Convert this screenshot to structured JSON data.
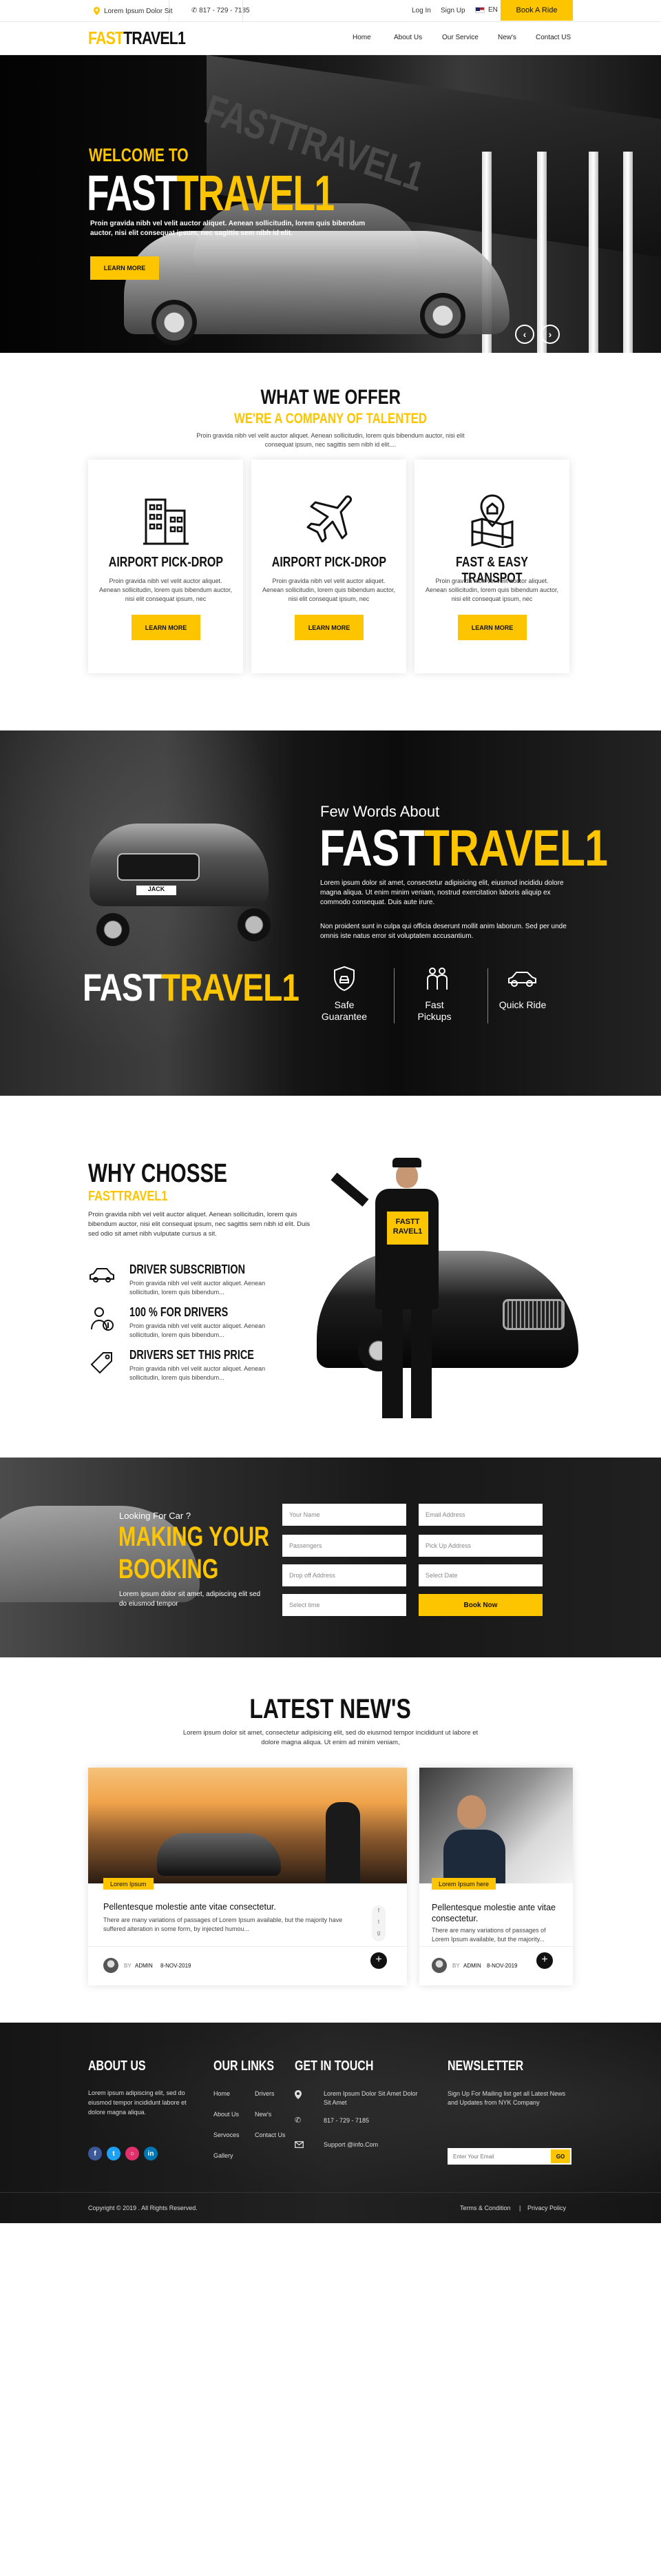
{
  "topbar": {
    "address": "Lorem Ipsum Dolor Sit",
    "phone": "817 - 729 - 7185",
    "login": "Log In",
    "signup": "Sign Up",
    "lang": "EN",
    "book_ride": "Book A Ride"
  },
  "brand": {
    "logo_a": "FAST",
    "logo_b": "TRAVEL1",
    "accent": "#fdc500"
  },
  "nav": {
    "items": [
      "Home",
      "About Us",
      "Our Service",
      "New's",
      "Contact US"
    ]
  },
  "hero": {
    "welcome": "WELCOME TO",
    "title_a": "FAST",
    "title_b": "TRAVEL1",
    "text": "Proin gravida nibh vel velit auctor aliquet. Aenean sollicitudin, lorem quis bibendum auctor, nisi elit consequat ipsum, nec sagittis sem nibh id elit.",
    "button": "LEARN MORE",
    "sign_text": "FASTTRAVEL1"
  },
  "offer": {
    "title": "WHAT WE OFFER",
    "subtitle": "WE'RE A COMPANY OF TALENTED",
    "text": "Proin gravida nibh vel velit auctor aliquet. Aenean sollicitudin, lorem quis bibendum auctor, nisi elit consequat ipsum, nec sagittis sem nibh id elit....",
    "cards": [
      {
        "title": "AIRPORT PICK-DROP",
        "text": "Proin gravida nibh vel velit auctor aliquet. Aenean sollicitudin, lorem quis bibendum auctor, nisi elit consequat ipsum, nec",
        "button": "LEARN MORE"
      },
      {
        "title": "AIRPORT PICK-DROP",
        "text": "Proin gravida nibh vel velit auctor aliquet. Aenean sollicitudin, lorem quis bibendum auctor, nisi elit consequat ipsum, nec",
        "button": "LEARN MORE"
      },
      {
        "title": "FAST & EASY TRANSPOT",
        "text": "Proin gravida nibh vel velit auctor aliquet. Aenean sollicitudin, lorem quis bibendum auctor, nisi elit consequat ipsum, nec",
        "button": "LEARN MORE"
      }
    ]
  },
  "about": {
    "kicker": "Few Words About",
    "title_a": "FAST",
    "title_b": "TRAVEL1",
    "p1": "Lorem ipsum dolor sit amet, consectetur adipisicing elit, eiusmod incididu dolore magna aliqua. Ut enim minim veniam, nostrud exercitation laboris aliquip ex commodo consequat. Duis aute irure.",
    "p2": "Non proident sunt in culpa qui officia deserunt mollit anim laborum. Sed per unde omnis iste natus error sit voluptatem accusantium.",
    "features": [
      {
        "label": "Safe Guarantee"
      },
      {
        "label": "Fast Pickups"
      },
      {
        "label": "Quick Ride"
      }
    ],
    "plate": "JACK"
  },
  "why": {
    "title": "WHY CHOSSE",
    "subtitle": "FASTTRAVEL1",
    "text": "Proin gravida nibh vel velit auctor aliquet. Aenean sollicitudin, lorem quis bibendum auctor, nisi elit consequat ipsum, nec sagittis sem nibh id elit. Duis sed odio sit amet nibh vulputate cursus a sit.",
    "items": [
      {
        "title": "DRIVER SUBSCRIBTION",
        "text": "Proin gravida nibh vel velit auctor aliquet. Aenean sollicitudin, lorem quis bibendum..."
      },
      {
        "title": "100 % FOR DRIVERS",
        "text": "Proin gravida nibh vel velit auctor aliquet. Aenean sollicitudin, lorem quis bibendum..."
      },
      {
        "title": "DRIVERS SET THIS PRICE",
        "text": "Proin gravida nibh vel velit auctor aliquet. Aenean sollicitudin, lorem quis bibendum..."
      }
    ],
    "sign": "FASTT RAVEL1"
  },
  "booking": {
    "kicker": "Looking For Car ?",
    "title1": "MAKING YOUR",
    "title2": "BOOKING",
    "text": "Lorem ipsum dolor sit amet, adipiscing elit sed do eiusmod tempor",
    "fields": [
      "Your Name",
      "Email Address",
      "Passengers",
      "Pick Up Address",
      "Drop off Address",
      "Select Date",
      "Select time"
    ],
    "button": "Book Now"
  },
  "news": {
    "title": "LATEST NEW'S",
    "text": "Lorem ipsum dolor sit amet, consectetur adipisicing elit, sed do eiusmod tempor incididunt ut labore et dolore magna aliqua. Ut enim ad minim veniam,",
    "cards": [
      {
        "tag": "Lorem Ipsum",
        "title": "Pellentesque molestie ante vitae consectetur.",
        "text": "There are many variations of passages of Lorem Ipsum available, but the majority have suffered alteration in some form, by injected humou...",
        "by": "BY",
        "author": "ADMIN",
        "date": "8-NOV-2019"
      },
      {
        "tag": "Lorem Ipsum here",
        "title": "Pellentesque molestie ante vitae consectetur.",
        "text": "There are many variations of passages of Lorem Ipsum available, but the majority...",
        "by": "BY",
        "author": "ADMIN",
        "date": "8-NOV-2019"
      }
    ]
  },
  "footer": {
    "about_title": "ABOUT US",
    "about_text": "Lorem ipsum adipiscing elit, sed do eiusmod tempor incididunt labore et dolore magna aliqua.",
    "links_title": "OUR LINKS",
    "links_col1": [
      "Home",
      "About Us",
      "Servoces",
      "Gallery"
    ],
    "links_col2": [
      "Drivers",
      "New's",
      "Contact Us"
    ],
    "touch_title": "GET IN TOUCH",
    "touch_address": "Lorem Ipsum Dolor Sit Amet Dolor Sit Amet",
    "touch_phone": "817 - 729 - 7185",
    "touch_email": "Support @info.Com",
    "newsletter_title": "NEWSLETTER",
    "newsletter_text": "Sign Up For Mailing list get all Latest News and Updates from NYK Company",
    "newsletter_placeholder": "Enter Your Email",
    "newsletter_button": "GO",
    "copyright": "Copyright © 2019 . All Rights Reserved.",
    "terms": "Terms & Condition",
    "privacy": "Privacy Policy"
  }
}
